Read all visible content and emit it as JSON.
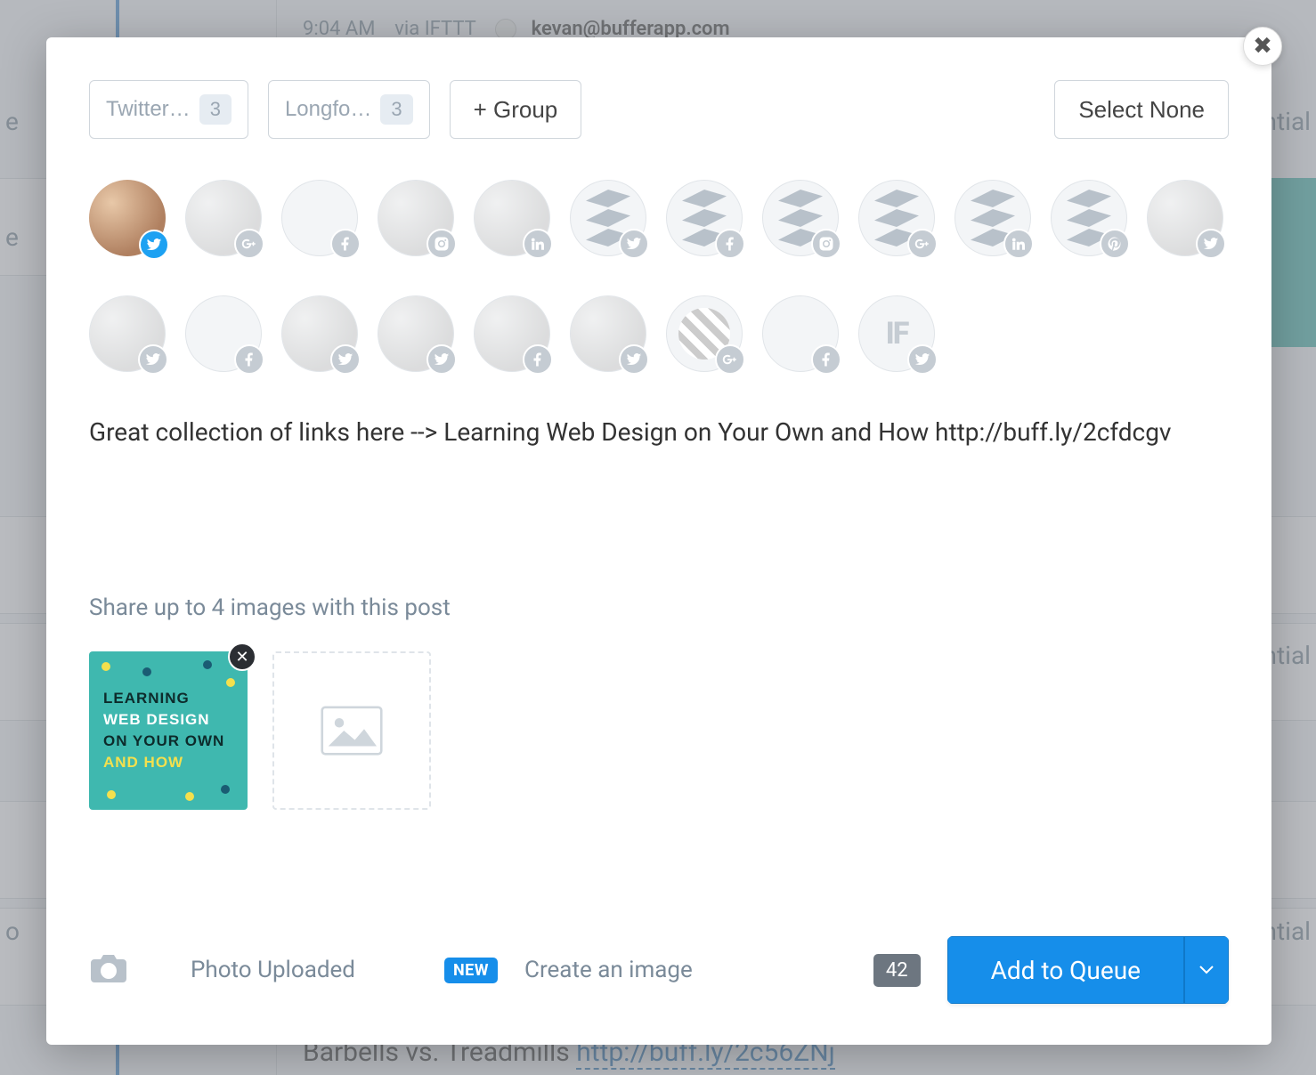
{
  "background": {
    "time": "9:04 AM",
    "via": "via IFTTT",
    "email": "kevan@bufferapp.com",
    "partial_right_1": "ntial",
    "partial_right_2": "ntial",
    "partial_left_1": "e",
    "partial_left_2": "e",
    "partial_left_3": "o",
    "bottom_text_pre": "Barbells vs. Treadmills ",
    "bottom_text_link": "http://buff.ly/2c56ZNj"
  },
  "modal": {
    "groups": [
      {
        "label": "Twitter…",
        "count": "3"
      },
      {
        "label": "Longfo…",
        "count": "3"
      }
    ],
    "add_group_label": "+ Group",
    "select_none_label": "Select None",
    "compose_text": "Great collection of links here --> Learning Web Design on Your Own and How http://buff.ly/2cfdcgv",
    "share_hint": "Share up to 4 images with this post",
    "image_thumb": {
      "line1": "LEARNING",
      "line2": "WEB DESIGN",
      "line3": "ON YOUR OWN",
      "line4": "AND HOW"
    },
    "footer": {
      "photo_status": "Photo Uploaded",
      "new_badge": "NEW",
      "create_image": "Create an image",
      "char_count": "42",
      "queue_label": "Add to Queue"
    },
    "profiles_row1": [
      {
        "type": "avatar",
        "network": "twitter",
        "selected": true
      },
      {
        "type": "avatar",
        "network": "googleplus"
      },
      {
        "type": "blank",
        "network": "facebook"
      },
      {
        "type": "avatar",
        "network": "instagram"
      },
      {
        "type": "avatar",
        "network": "linkedin"
      },
      {
        "type": "buffer",
        "network": "twitter"
      },
      {
        "type": "buffer",
        "network": "facebook"
      },
      {
        "type": "buffer",
        "network": "instagram"
      },
      {
        "type": "buffer",
        "network": "googleplus"
      },
      {
        "type": "buffer",
        "network": "linkedin"
      },
      {
        "type": "buffer",
        "network": "pinterest"
      },
      {
        "type": "avatar",
        "network": "twitter"
      }
    ],
    "profiles_row2": [
      {
        "type": "avatar",
        "network": "twitter"
      },
      {
        "type": "blank",
        "network": "facebook"
      },
      {
        "type": "avatar",
        "network": "twitter"
      },
      {
        "type": "avatar",
        "network": "twitter"
      },
      {
        "type": "avatar",
        "network": "facebook"
      },
      {
        "type": "avatar",
        "network": "twitter"
      },
      {
        "type": "stripes",
        "network": "googleplus"
      },
      {
        "type": "blank",
        "network": "facebook"
      },
      {
        "type": "if",
        "network": "twitter"
      }
    ]
  }
}
